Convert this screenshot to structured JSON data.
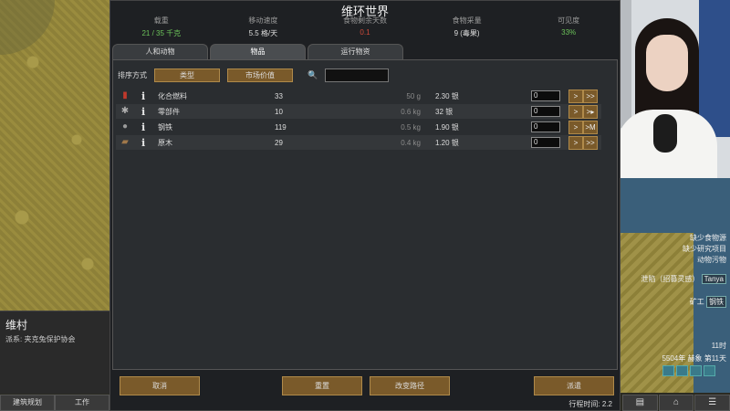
{
  "title": "维环世界",
  "stats": [
    {
      "label": "载重",
      "value": "21 / 35 千克",
      "color": "green"
    },
    {
      "label": "移动速度",
      "value": "5.5 格/天",
      "color": "normal"
    },
    {
      "label": "食物剩余天数",
      "value": "0.1",
      "color": "red"
    },
    {
      "label": "食物采量",
      "value": "9 (毒果)",
      "color": "normal"
    },
    {
      "label": "可见度",
      "value": "33%",
      "color": "green"
    }
  ],
  "tabs": [
    "人和动物",
    "物品",
    "运行物资"
  ],
  "active_tab": "物品",
  "sort": {
    "label": "排序方式",
    "by_type": "类型",
    "by_value": "市场价值"
  },
  "search": {
    "value": ""
  },
  "items": [
    {
      "icon": "chemfuel-icon",
      "glyph": "▮",
      "glyph_color": "#c0392b",
      "name": "化合燃料",
      "qty": "33",
      "mass": "50 g",
      "price": "2.30 银",
      "count": "0",
      "btn1": ">",
      "btn2": ">>"
    },
    {
      "icon": "components-icon",
      "glyph": "✱",
      "glyph_color": "#b0b0b0",
      "name": "零部件",
      "qty": "10",
      "mass": "0.6 kg",
      "price": "32 银",
      "count": "0",
      "btn1": ">",
      "btn2": ">▸"
    },
    {
      "icon": "steel-icon",
      "glyph": "●",
      "glyph_color": "#9a9a9a",
      "name": "钢铁",
      "qty": "119",
      "mass": "0.5 kg",
      "price": "1.90 银",
      "count": "0",
      "btn1": ">",
      "btn2": ">M"
    },
    {
      "icon": "wood-icon",
      "glyph": "▰",
      "glyph_color": "#a0784a",
      "name": "原木",
      "qty": "29",
      "mass": "0.4 kg",
      "price": "1.20 银",
      "count": "0",
      "btn1": ">",
      "btn2": ">>"
    }
  ],
  "buttons": {
    "cancel": "取消",
    "reset": "重置",
    "change_route": "改变路径",
    "send": "派遣"
  },
  "trip_time": "行程时间:  2.2",
  "settlement": {
    "name": "维村",
    "faction": "派系: 夹克兔保护协会"
  },
  "bottom_left": {
    "build": "建筑规划",
    "work": "工作"
  },
  "alerts": [
    "缺少食物源",
    "缺少研究项目",
    "动物污物"
  ],
  "pawns": [
    {
      "label": "泄陷（招募灵感）",
      "name": "Tanya"
    },
    {
      "label": "矿工",
      "name": "钢铁"
    }
  ],
  "time": {
    "hour": "11时",
    "date": "5504年 赫象 第11天"
  }
}
